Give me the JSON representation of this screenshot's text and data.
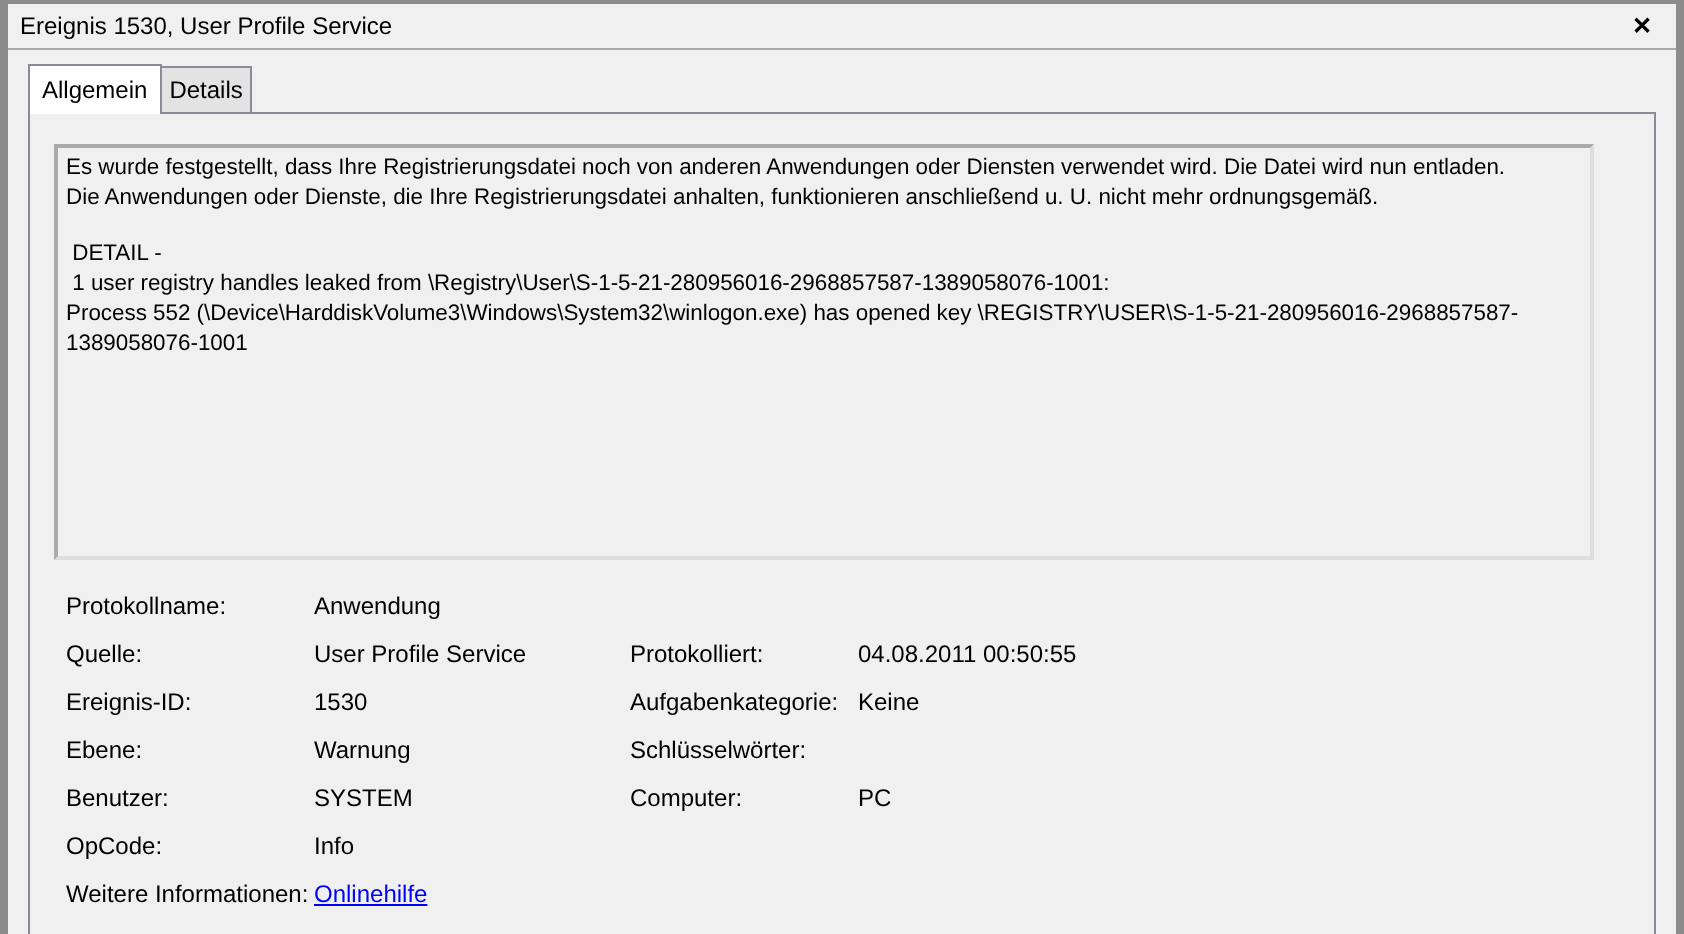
{
  "window": {
    "title": "Ereignis 1530, User Profile Service",
    "close": "✕"
  },
  "tabs": [
    {
      "label": "Allgemein",
      "selected": true
    },
    {
      "label": "Details",
      "selected": false
    }
  ],
  "message": {
    "paragraphs": [
      [
        "Es wurde festgestellt, dass Ihre Registrierungsdatei noch von anderen Anwendungen oder Diensten verwendet wird. Die Datei wird nun entladen.",
        "Die Anwendungen oder Dienste, die Ihre Registrierungsdatei anhalten, funktionieren anschließend u. U. nicht mehr ordnungsgemäß."
      ],
      [
        " DETAIL -",
        " 1 user registry handles leaked from \\Registry\\User\\S-1-5-21-280956016-2968857587-1389058076-1001:",
        "Process 552 (\\Device\\HarddiskVolume3\\Windows\\System32\\winlogon.exe) has opened key \\REGISTRY\\USER\\S-1-5-21-280956016-2968857587-",
        "1389058076-1001"
      ]
    ]
  },
  "fields": [
    {
      "label": "Protokollname:",
      "value": "Anwendung"
    },
    {
      "label": "Quelle:",
      "value": "User Profile Service",
      "label_2": "Protokolliert:",
      "value_2": "04.08.2011 00:50:55"
    },
    {
      "label": "Ereignis-ID:",
      "value": "1530",
      "label_2": "Aufgabenkategorie:",
      "value_2": "Keine"
    },
    {
      "label": "Ebene:",
      "value": "Warnung",
      "label_2": "Schlüsselwörter:"
    },
    {
      "label": "Benutzer:",
      "value": "SYSTEM",
      "label_2": "Computer:",
      "value_2": "PC"
    },
    {
      "label": "OpCode:",
      "value": "Info"
    },
    {
      "label": "Weitere Informationen:",
      "value": "Onlinehilfe",
      "kind": "link"
    }
  ]
}
